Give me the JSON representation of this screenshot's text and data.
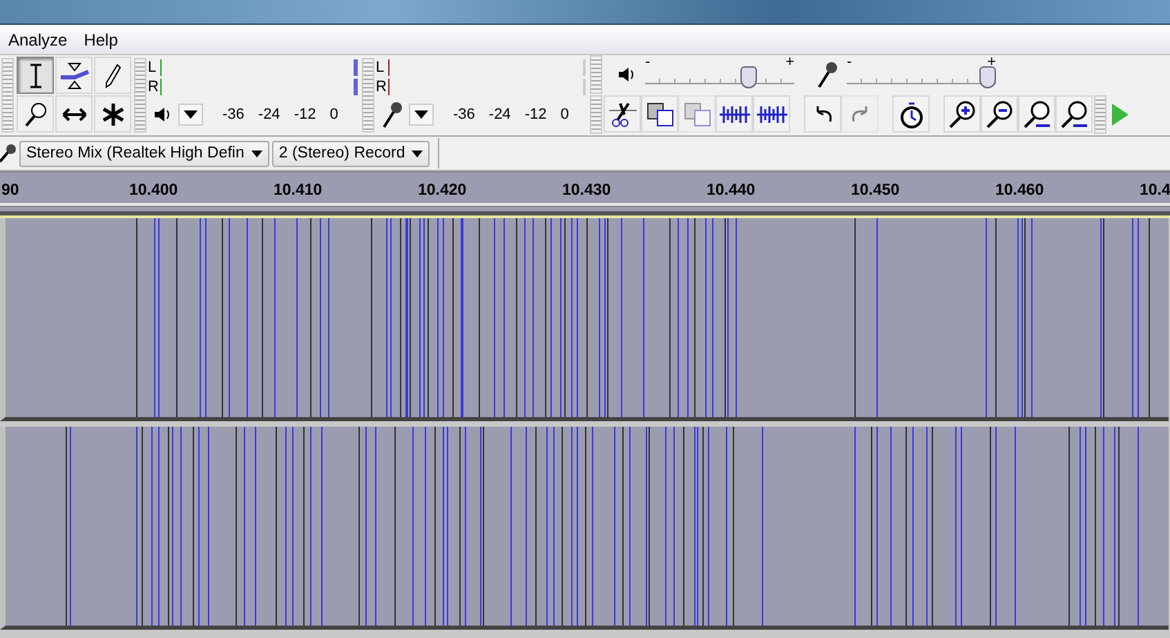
{
  "menu": [
    "Analyze",
    "Help"
  ],
  "tools": [
    {
      "kind": "select",
      "selected": true
    },
    {
      "kind": "envelope",
      "selected": false
    },
    {
      "kind": "draw",
      "selected": false
    },
    {
      "kind": "zoom",
      "selected": false
    },
    {
      "kind": "timeshift",
      "selected": false
    },
    {
      "kind": "multi",
      "selected": false
    }
  ],
  "meters": [
    {
      "kind": "playback",
      "channels": [
        "L",
        "R"
      ],
      "scale": [
        "-36",
        "-24",
        "-12",
        "0"
      ]
    },
    {
      "kind": "record",
      "channels": [
        "L",
        "R"
      ],
      "scale": [
        "-36",
        "-24",
        "-12",
        "0"
      ]
    }
  ],
  "mixer": [
    {
      "kind": "output",
      "minus": "-",
      "plus": "+",
      "level": 0.72
    },
    {
      "kind": "input",
      "minus": "-",
      "plus": "+",
      "level": 1.0
    }
  ],
  "edit_buttons": [
    {
      "kind": "cut",
      "disabled": false
    },
    {
      "kind": "copy",
      "disabled": false
    },
    {
      "kind": "paste",
      "disabled": true
    },
    {
      "kind": "trim",
      "disabled": false
    },
    {
      "kind": "silence",
      "disabled": false
    },
    {
      "kind": "undo",
      "disabled": false
    },
    {
      "kind": "redo",
      "disabled": true
    },
    {
      "kind": "sync",
      "disabled": false
    },
    {
      "kind": "zoom-in",
      "disabled": false
    },
    {
      "kind": "zoom-out",
      "disabled": false
    },
    {
      "kind": "fit",
      "disabled": false
    },
    {
      "kind": "fit-v",
      "disabled": false
    }
  ],
  "devices": [
    "Stereo Mix (Realtek High Defin",
    "2 (Stereo) Record"
  ],
  "ruler": [
    "90",
    "10.400",
    "10.410",
    "10.420",
    "10.430",
    "10.440",
    "10.450",
    "10.460",
    "10.4"
  ]
}
